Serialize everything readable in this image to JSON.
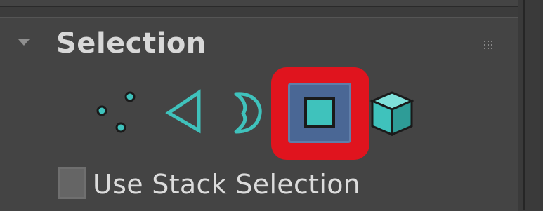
{
  "rollout": {
    "title": "Selection",
    "collapsed": false
  },
  "selection_levels": [
    {
      "name": "vertex",
      "icon": "vertex-dots-icon",
      "active": false
    },
    {
      "name": "edge",
      "icon": "edge-triangle-icon",
      "active": false
    },
    {
      "name": "border",
      "icon": "border-crescent-icon",
      "active": false
    },
    {
      "name": "polygon",
      "icon": "polygon-square-icon",
      "active": true
    },
    {
      "name": "element",
      "icon": "element-cube-icon",
      "active": false
    }
  ],
  "options": {
    "use_stack_selection_label": "Use Stack Selection",
    "use_stack_selection_checked": false
  },
  "colors": {
    "panel_bg": "#444444",
    "icon_teal": "#3fc2bc",
    "active_bg": "#4a6795",
    "highlight_red": "#e0141e",
    "text": "#d8d8d8"
  }
}
